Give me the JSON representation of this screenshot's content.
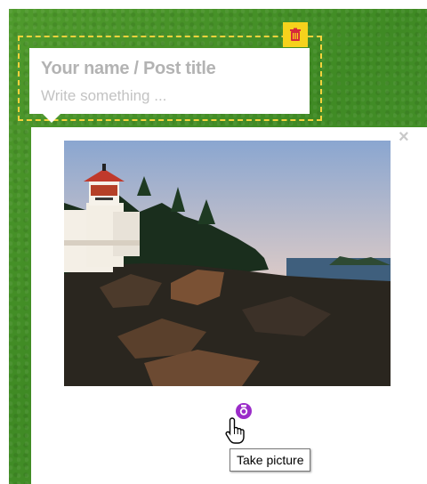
{
  "post": {
    "title_placeholder": "Your name / Post title",
    "body_placeholder": "Write something ..."
  },
  "icons": {
    "delete": "trash-icon",
    "close": "close-icon",
    "camera": "camera-icon",
    "cursor": "hand-pointer-icon"
  },
  "close_glyph": "×",
  "tooltip": {
    "text": "Take picture"
  },
  "image": {
    "subject": "lighthouse on rocky coast at sunset"
  },
  "colors": {
    "board": "#4a962a",
    "dashed_border": "#f3d23c",
    "delete_button": "#f6d21c",
    "delete_icon": "#d6283a",
    "camera_icon": "#9b2cc9",
    "placeholder_text": "#b3b3b3"
  }
}
